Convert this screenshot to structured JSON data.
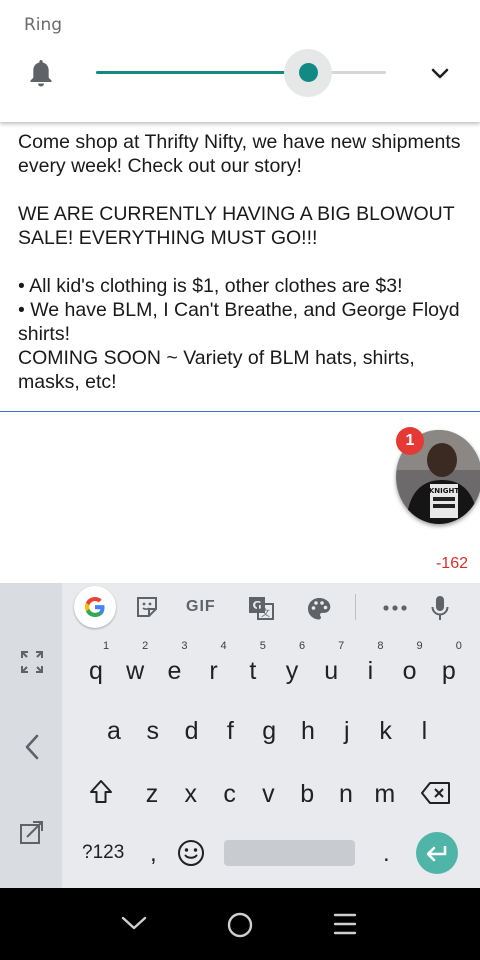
{
  "volume_panel": {
    "label": "Ring",
    "level_fraction": 0.73,
    "accent_color": "#128a84",
    "icons": [
      "bell-icon",
      "chevron-down-icon"
    ]
  },
  "post": {
    "text": "Come shop at Thrifty Nifty, we have new shipments every week! Check out our story!\n\nWE ARE CURRENTLY HAVING A BIG BLOWOUT SALE! EVERYTHING MUST GO!!!\n\n• All kid's clothing is $1, other clothes are $3!\n• We have BLM, I Can't Breathe, and George Floyd shirts!\nCOMING SOON ~ Variety of BLM hats, shirts, masks, etc!"
  },
  "chat_head": {
    "badge_count": "1",
    "shirt_text": "KNIGHT"
  },
  "char_counter": "-162",
  "keyboard": {
    "toolbar": {
      "gif_label": "GIF",
      "icons": [
        "google-icon",
        "sticker-icon",
        "gif-icon",
        "translate-icon",
        "palette-icon",
        "more-icon",
        "mic-icon"
      ]
    },
    "row1": [
      "q",
      "w",
      "e",
      "r",
      "t",
      "y",
      "u",
      "i",
      "o",
      "p"
    ],
    "row1_hints": [
      "1",
      "2",
      "3",
      "4",
      "5",
      "6",
      "7",
      "8",
      "9",
      "0"
    ],
    "row2": [
      "a",
      "s",
      "d",
      "f",
      "g",
      "h",
      "j",
      "k",
      "l"
    ],
    "row3": [
      "z",
      "x",
      "c",
      "v",
      "b",
      "n",
      "m"
    ],
    "symbols_label": "?123",
    "comma": ",",
    "period": ".",
    "side_icons": [
      "expand-icon",
      "back-chevron-icon",
      "floating-keyboard-icon"
    ]
  },
  "nav_bar": {
    "icons": [
      "nav-back-icon",
      "nav-home-icon",
      "nav-recents-icon"
    ]
  }
}
